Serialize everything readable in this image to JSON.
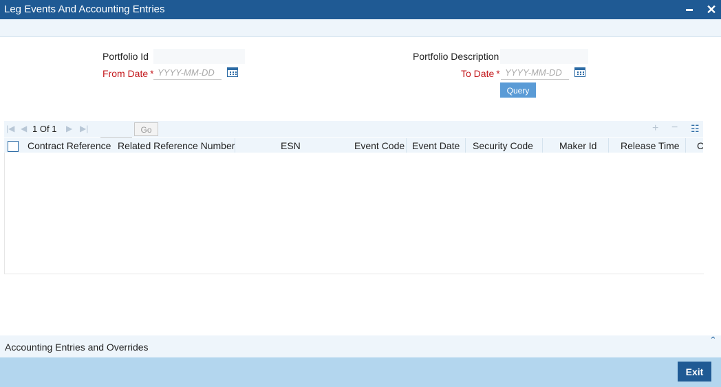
{
  "window": {
    "title": "Leg Events And Accounting Entries"
  },
  "form": {
    "portfolio_id": {
      "label": "Portfolio Id",
      "value": ""
    },
    "portfolio_description": {
      "label": "Portfolio Description",
      "value": ""
    },
    "from_date": {
      "label": "From Date",
      "required_mark": "*",
      "placeholder": "YYYY-MM-DD"
    },
    "to_date": {
      "label": "To Date",
      "required_mark": "*",
      "placeholder": "YYYY-MM-DD"
    },
    "query_label": "Query"
  },
  "grid": {
    "page_current": "1",
    "page_of": "Of",
    "page_total": "1",
    "go_label": "Go",
    "columns": [
      "Contract Reference",
      "Related Reference Number",
      "ESN",
      "Event Code",
      "Event Date",
      "Security Code",
      "Maker Id",
      "Release Time",
      "Ch"
    ],
    "rows": []
  },
  "accounting_section": {
    "label": "Accounting Entries and Overrides"
  },
  "footer": {
    "exit_label": "Exit"
  },
  "colors": {
    "title_bar": "#1f5a94",
    "accent": "#2c6ba5",
    "required": "#c3171b",
    "footer": "#b3d6ee",
    "query_button": "#5a9bd6"
  }
}
